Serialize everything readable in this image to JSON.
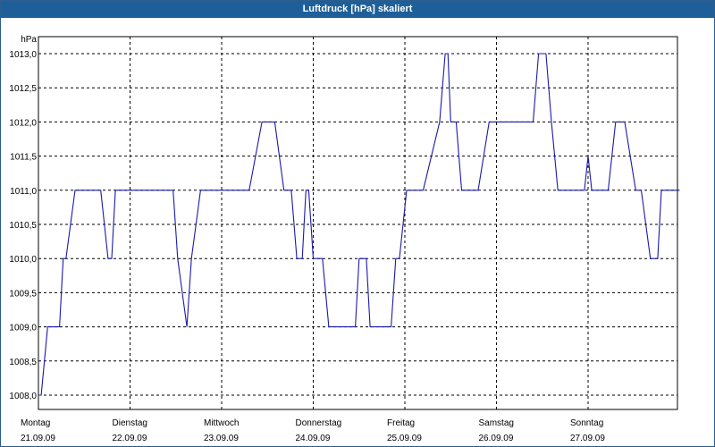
{
  "window": {
    "title": "Luftdruck [hPa] skaliert"
  },
  "chart_data": {
    "type": "line",
    "title": "Luftdruck [hPa] skaliert",
    "ylabel": "hPa",
    "xlabel": "",
    "ylim": [
      1008.0,
      1013.0
    ],
    "xlim": [
      0,
      7
    ],
    "grid": true,
    "line_color": "#1a1aaa",
    "y_ticks": [
      "1013,0",
      "1012,5",
      "1012,0",
      "1011,5",
      "1011,0",
      "1010,5",
      "1010,0",
      "1009,5",
      "1009,0",
      "1008,5",
      "1008,0"
    ],
    "y_tick_values": [
      1013.0,
      1012.5,
      1012.0,
      1011.5,
      1011.0,
      1010.5,
      1010.0,
      1009.5,
      1009.0,
      1008.5,
      1008.0
    ],
    "x_ticks": [
      {
        "day": "Montag",
        "date": "21.09.09"
      },
      {
        "day": "Dienstag",
        "date": "22.09.09"
      },
      {
        "day": "Mittwoch",
        "date": "23.09.09"
      },
      {
        "day": "Donnerstag",
        "date": "24.09.09"
      },
      {
        "day": "Freitag",
        "date": "25.09.09"
      },
      {
        "day": "Samstag",
        "date": "26.09.09"
      },
      {
        "day": "Sonntag",
        "date": "27.09.09"
      }
    ],
    "series": [
      {
        "x": [
          0,
          0.03,
          0.1,
          0.23,
          0.27,
          0.3,
          0.4,
          0.68,
          0.76,
          0.8,
          0.84,
          0.87,
          1.0,
          1.1,
          1.3,
          1.47,
          1.52,
          1.62,
          1.67,
          1.77,
          1.82,
          1.87,
          1.96,
          2.0,
          2.2,
          2.3,
          2.44,
          2.58,
          2.68,
          2.76,
          2.82,
          2.88,
          2.92,
          2.95,
          3.0,
          3.1,
          3.17,
          3.2,
          3.25,
          3.46,
          3.5,
          3.58,
          3.62,
          3.7,
          3.85,
          3.9,
          3.94,
          4.02,
          4.08,
          4.1,
          4.2,
          4.38,
          4.44,
          4.47,
          4.5,
          4.53,
          4.56,
          4.62,
          4.7,
          4.8,
          4.92,
          5.0,
          5.1,
          5.24,
          5.4,
          5.46,
          5.54,
          5.6,
          5.67,
          5.72,
          5.82,
          5.86,
          5.96,
          6.0,
          6.04,
          6.08,
          6.14,
          6.22,
          6.3,
          6.4,
          6.52,
          6.58,
          6.68,
          6.76,
          6.8,
          6.96,
          7.0
        ],
        "y": [
          1008.0,
          1008.0,
          1009.0,
          1009.0,
          1010.0,
          1010.0,
          1011.0,
          1011.0,
          1010.0,
          1010.0,
          1011.0,
          1011.0,
          1011.0,
          1011.0,
          1011.0,
          1011.0,
          1010.0,
          1009.0,
          1010.0,
          1011.0,
          1011.0,
          1011.0,
          1011.0,
          1011.0,
          1011.0,
          1011.0,
          1012.0,
          1012.0,
          1011.0,
          1011.0,
          1010.0,
          1010.0,
          1011.0,
          1011.0,
          1010.0,
          1010.0,
          1009.0,
          1009.0,
          1009.0,
          1009.0,
          1010.0,
          1010.0,
          1009.0,
          1009.0,
          1009.0,
          1010.0,
          1010.0,
          1011.0,
          1011.0,
          1011.0,
          1011.0,
          1012.0,
          1013.0,
          1013.0,
          1012.0,
          1012.0,
          1012.0,
          1011.0,
          1011.0,
          1011.0,
          1012.0,
          1012.0,
          1012.0,
          1012.0,
          1012.0,
          1013.0,
          1013.0,
          1012.0,
          1011.0,
          1011.0,
          1011.0,
          1011.0,
          1011.0,
          1011.5,
          1011.0,
          1011.0,
          1011.0,
          1011.0,
          1012.0,
          1012.0,
          1011.0,
          1011.0,
          1010.0,
          1010.0,
          1011.0,
          1011.0,
          1011.0
        ]
      }
    ]
  }
}
